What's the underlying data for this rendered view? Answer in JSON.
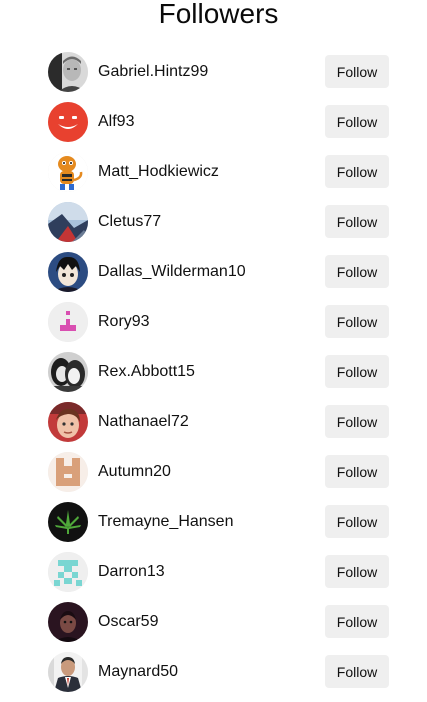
{
  "page": {
    "title": "Followers"
  },
  "follow_label": "Follow",
  "followers": [
    {
      "username": "Gabriel.Hintz99",
      "avatar_icon": "portrait-photo-icon",
      "avatar_colors": [
        "#3a3a3a",
        "#d8d8d8"
      ]
    },
    {
      "username": "Alf93",
      "avatar_icon": "smiley-face-icon",
      "avatar_colors": [
        "#e8412f",
        "#ffffff"
      ]
    },
    {
      "username": "Matt_Hodkiewicz",
      "avatar_icon": "tiger-cartoon-icon",
      "avatar_colors": [
        "#ffffff",
        "#e58a1f"
      ]
    },
    {
      "username": "Cletus77",
      "avatar_icon": "landscape-photo-icon",
      "avatar_colors": [
        "#9fb9d6",
        "#2f3e5c"
      ]
    },
    {
      "username": "Dallas_Wilderman10",
      "avatar_icon": "anime-portrait-icon",
      "avatar_colors": [
        "#2c4c82",
        "#f2e6d8"
      ]
    },
    {
      "username": "Rory93",
      "avatar_icon": "pixel-identicon-icon",
      "avatar_colors": [
        "#efefef",
        "#d94fb1"
      ]
    },
    {
      "username": "Rex.Abbott15",
      "avatar_icon": "couple-photo-icon",
      "avatar_colors": [
        "#d0d0d0",
        "#222222"
      ]
    },
    {
      "username": "Nathanael72",
      "avatar_icon": "selfie-photo-icon",
      "avatar_colors": [
        "#c23a3a",
        "#f0c2a8"
      ]
    },
    {
      "username": "Autumn20",
      "avatar_icon": "pixel-identicon-icon",
      "avatar_colors": [
        "#f7eee8",
        "#d9a07a"
      ]
    },
    {
      "username": "Tremayne_Hansen",
      "avatar_icon": "cannabis-leaf-icon",
      "avatar_colors": [
        "#111111",
        "#4fa83a"
      ]
    },
    {
      "username": "Darron13",
      "avatar_icon": "pixel-identicon-icon",
      "avatar_colors": [
        "#efefef",
        "#7ad6d2"
      ]
    },
    {
      "username": "Oscar59",
      "avatar_icon": "dark-portrait-photo-icon",
      "avatar_colors": [
        "#2a1420",
        "#c49080"
      ]
    },
    {
      "username": "Maynard50",
      "avatar_icon": "man-in-suit-photo-icon",
      "avatar_colors": [
        "#f2f2f2",
        "#c0392b"
      ]
    }
  ]
}
